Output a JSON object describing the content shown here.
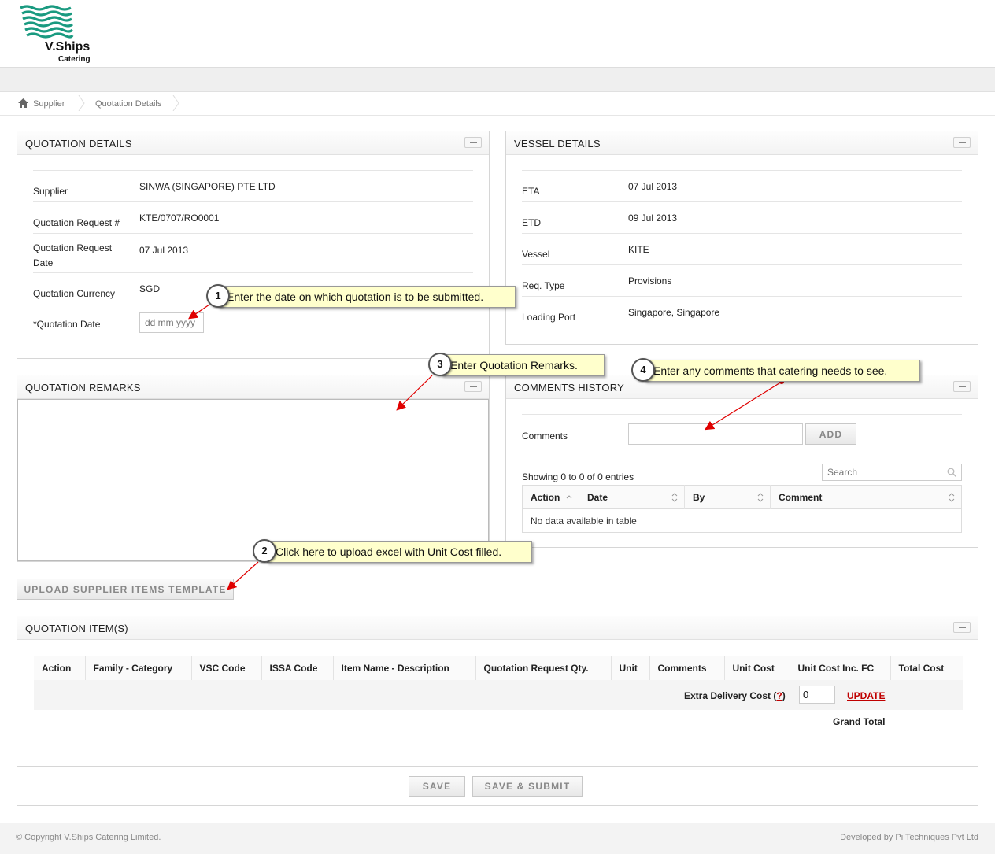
{
  "brand": {
    "name": "V.Ships",
    "sub": "Catering"
  },
  "breadcrumb": [
    "Supplier",
    "Quotation Details"
  ],
  "quotation_details": {
    "title": "QUOTATION DETAILS",
    "supplier_label": "Supplier",
    "supplier_value": "SINWA (SINGAPORE) PTE LTD",
    "request_no_label": "Quotation Request #",
    "request_no_value": "KTE/0707/RO0001",
    "request_date_label_1": "Quotation Request",
    "request_date_label_2": "Date",
    "request_date_value": "07 Jul 2013",
    "currency_label": "Quotation Currency",
    "currency_value": "SGD",
    "quotation_date_label": "*Quotation Date",
    "quotation_date_placeholder": "dd mm yyyy"
  },
  "vessel_details": {
    "title": "VESSEL DETAILS",
    "eta_label": "ETA",
    "eta_value": "07 Jul 2013",
    "etd_label": "ETD",
    "etd_value": "09 Jul 2013",
    "vessel_label": "Vessel",
    "vessel_value": "KITE",
    "req_type_label": "Req. Type",
    "req_type_value": "Provisions",
    "port_label": "Loading Port",
    "port_value": "Singapore, Singapore"
  },
  "remarks": {
    "title": "QUOTATION REMARKS",
    "upload_label": "UPLOAD SUPPLIER ITEMS TEMPLATE"
  },
  "comments": {
    "title": "COMMENTS HISTORY",
    "comments_label": "Comments",
    "add_label": "ADD",
    "showing": "Showing 0 to 0 of 0 entries",
    "search_placeholder": "Search",
    "columns": [
      "Action",
      "Date",
      "By",
      "Comment"
    ],
    "empty": "No data available in table"
  },
  "items": {
    "title": "QUOTATION ITEM(S)",
    "columns": [
      "Action",
      "Family - Category",
      "VSC Code",
      "ISSA Code",
      "Item Name - Description",
      "Quotation Request Qty.",
      "Unit",
      "Comments",
      "Unit Cost",
      "Unit Cost Inc. FC",
      "Total Cost"
    ],
    "extra_delivery_label": "Extra Delivery Cost (",
    "extra_delivery_help": "?",
    "extra_delivery_close": ")",
    "extra_delivery_value": "0",
    "update_label": "UPDATE",
    "grand_total_label": "Grand Total"
  },
  "actions": {
    "save_label": "SAVE",
    "save_submit_label": "SAVE & SUBMIT"
  },
  "callouts": [
    {
      "num": "1",
      "text": "Enter the date on which quotation is to be submitted."
    },
    {
      "num": "2",
      "text": "Click here to upload excel with Unit Cost filled."
    },
    {
      "num": "3",
      "text": "Enter Quotation Remarks."
    },
    {
      "num": "4",
      "text": "Enter any comments that catering needs to see."
    }
  ],
  "footer": {
    "copyright": "© Copyright V.Ships Catering Limited.",
    "developed_by": "Developed by ",
    "developer": "Pi Techniques Pvt Ltd"
  },
  "colors": {
    "logo_green": "#1a9a80",
    "callout_bg": "#ffffcc",
    "arrow_red": "#e00000",
    "link_red": "#c00000"
  }
}
